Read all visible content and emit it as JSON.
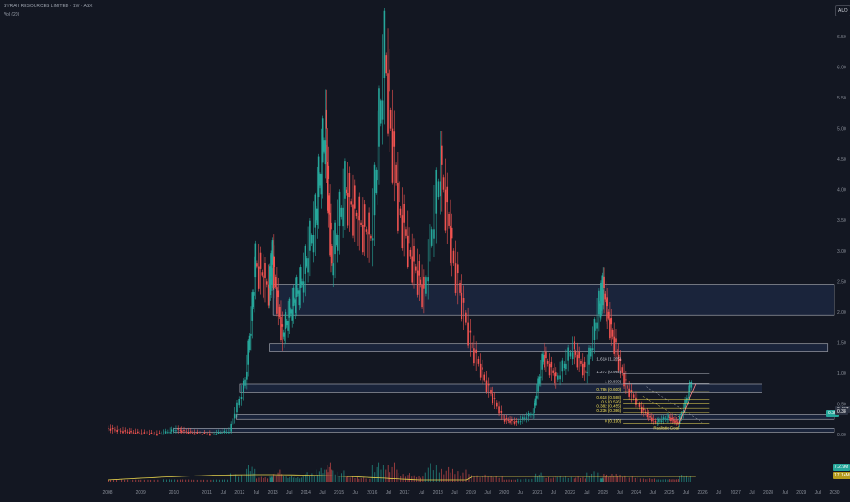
{
  "header": {
    "title": "SYRAH RESOURCES LIMITED · 1W · ASX",
    "volume_label": "Vol (20)",
    "currency": "AUD"
  },
  "colors": {
    "background": "#131722",
    "up": "#26a69a",
    "down": "#ef5350",
    "zone_fill": "#1e2a44",
    "zone_border": "#b2b5be",
    "volume_ma": "#e8d44d",
    "fib_yellow": "#f7e359"
  },
  "price_badges": [
    {
      "label": "0.35",
      "color": "#26a69a"
    },
    {
      "label": "0.407",
      "color": "#2b3140"
    },
    {
      "label": "0.38",
      "color": "#2b3140"
    }
  ],
  "volume_badges": [
    {
      "label": "7.2.9M",
      "color": "#26a69a"
    },
    {
      "label": "17.14M",
      "color": "#b59a1d"
    }
  ],
  "chart_data": {
    "type": "candlestick",
    "title": "SYRAH RESOURCES LIMITED · 1W · ASX",
    "ylabel": "AUD",
    "y_ticks": [
      "6.50",
      "6.00",
      "5.50",
      "5.00",
      "4.50",
      "4.00",
      "3.50",
      "3.00",
      "2.50",
      "2.00",
      "1.50",
      "1.00",
      "0.50",
      "0.00"
    ],
    "x_ticks": [
      "2008",
      "2009",
      "2010",
      "2011",
      "Jul",
      "2012",
      "Jul",
      "2013",
      "Jul",
      "2014",
      "Jul",
      "2015",
      "Jul",
      "2016",
      "Jul",
      "2017",
      "Jul",
      "2018",
      "Jul",
      "2019",
      "Jul",
      "2020",
      "Jul",
      "2021",
      "Jul",
      "2022",
      "Jul",
      "2023",
      "Jul",
      "2024",
      "Jul",
      "2025",
      "Jul",
      "2026",
      "Jul",
      "2027",
      "Jul",
      "2028",
      "Jul",
      "2029",
      "Jul",
      "2030"
    ],
    "ylim": [
      0.0,
      6.6
    ],
    "price_path": [
      {
        "x": 2008.0,
        "y": 0.1
      },
      {
        "x": 2008.5,
        "y": 0.05
      },
      {
        "x": 2009.0,
        "y": 0.02
      },
      {
        "x": 2009.6,
        "y": 0.0
      },
      {
        "x": 2010.1,
        "y": 0.08
      },
      {
        "x": 2010.6,
        "y": 0.02
      },
      {
        "x": 2011.2,
        "y": 0.0
      },
      {
        "x": 2011.7,
        "y": 0.05
      },
      {
        "x": 2012.2,
        "y": 0.9
      },
      {
        "x": 2012.5,
        "y": 2.8
      },
      {
        "x": 2012.9,
        "y": 2.4
      },
      {
        "x": 2013.0,
        "y": 2.9
      },
      {
        "x": 2013.3,
        "y": 1.6
      },
      {
        "x": 2013.6,
        "y": 2.1
      },
      {
        "x": 2013.9,
        "y": 2.5
      },
      {
        "x": 2014.3,
        "y": 3.5
      },
      {
        "x": 2014.6,
        "y": 5.0
      },
      {
        "x": 2014.8,
        "y": 2.8
      },
      {
        "x": 2015.2,
        "y": 4.0
      },
      {
        "x": 2015.6,
        "y": 3.5
      },
      {
        "x": 2016.0,
        "y": 3.2
      },
      {
        "x": 2016.4,
        "y": 6.2
      },
      {
        "x": 2016.8,
        "y": 3.8
      },
      {
        "x": 2017.2,
        "y": 2.9
      },
      {
        "x": 2017.6,
        "y": 2.3
      },
      {
        "x": 2018.1,
        "y": 4.4
      },
      {
        "x": 2018.5,
        "y": 2.8
      },
      {
        "x": 2019.0,
        "y": 1.5
      },
      {
        "x": 2019.5,
        "y": 0.8
      },
      {
        "x": 2020.0,
        "y": 0.25
      },
      {
        "x": 2020.4,
        "y": 0.2
      },
      {
        "x": 2020.9,
        "y": 0.35
      },
      {
        "x": 2021.2,
        "y": 1.3
      },
      {
        "x": 2021.6,
        "y": 0.9
      },
      {
        "x": 2022.1,
        "y": 1.4
      },
      {
        "x": 2022.5,
        "y": 1.0
      },
      {
        "x": 2022.9,
        "y": 2.1
      },
      {
        "x": 2023.0,
        "y": 2.4
      },
      {
        "x": 2023.3,
        "y": 1.6
      },
      {
        "x": 2023.7,
        "y": 0.8
      },
      {
        "x": 2024.2,
        "y": 0.4
      },
      {
        "x": 2024.6,
        "y": 0.2
      },
      {
        "x": 2025.0,
        "y": 0.28
      },
      {
        "x": 2025.3,
        "y": 0.18
      },
      {
        "x": 2025.7,
        "y": 0.85
      }
    ],
    "zones": [
      {
        "y_low": 1.95,
        "y_high": 2.45,
        "x_start": 2013.0,
        "x_end": 2030.0
      },
      {
        "y_low": 1.35,
        "y_high": 1.48,
        "x_start": 2012.9,
        "x_end": 2029.8
      },
      {
        "y_low": 0.68,
        "y_high": 0.82,
        "x_start": 2012.0,
        "x_end": 2027.8
      },
      {
        "y_low": 0.25,
        "y_high": 0.32,
        "x_start": 2011.9,
        "x_end": 2030.0
      },
      {
        "y_low": 0.04,
        "y_high": 0.1,
        "x_start": 2010.0,
        "x_end": 2030.0
      }
    ],
    "fib_levels": [
      {
        "label": "1.618 (1.205)",
        "value": 1.2
      },
      {
        "label": "1.272 (0.995)",
        "value": 0.99
      },
      {
        "label": "1 (0.830)",
        "value": 0.83
      },
      {
        "label": "0.786 (0.600)",
        "value": 0.7
      },
      {
        "label": "0.618 (0.598)",
        "value": 0.57
      },
      {
        "label": "0.5 (0.526)",
        "value": 0.5
      },
      {
        "label": "0.382 (0.455)",
        "value": 0.43
      },
      {
        "label": "0.236 (0.366)",
        "value": 0.36
      },
      {
        "label": "0 (0.190)",
        "value": 0.19
      }
    ],
    "annotation": "Realistic Goal"
  }
}
